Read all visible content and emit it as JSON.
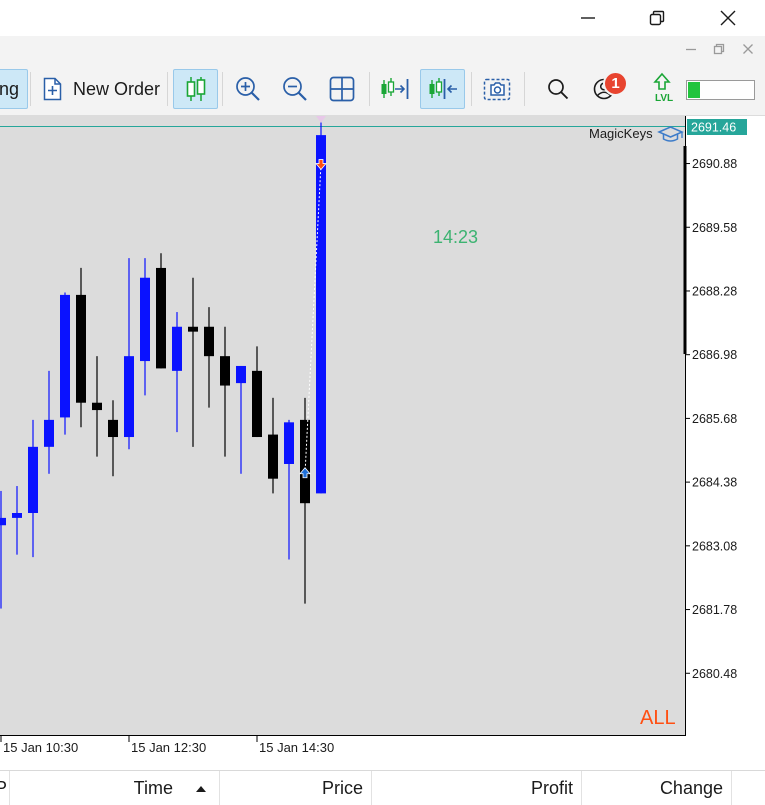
{
  "toolbar": {
    "trading_label": "ng",
    "new_order_label": "New Order",
    "notification_count": "1",
    "level_label": "LVL",
    "meter_fill": 0.18
  },
  "chart": {
    "current_price_label": "2691.46",
    "indicator_label": "MagicKeys",
    "countdown": "14:23",
    "filter_label": "ALL",
    "colors": {
      "background": "#dcdcdc",
      "bull": "#0a12ff",
      "bear": "#000000",
      "countdown": "#3cb371",
      "filter": "#ff4f12",
      "price_label_bg": "#26a69a"
    }
  },
  "chart_data": {
    "type": "candlestick",
    "timeframe": "M15",
    "price_ticks": [
      "2690.88",
      "2689.58",
      "2688.28",
      "2686.98",
      "2685.68",
      "2684.38",
      "2683.08",
      "2681.78",
      "2680.48"
    ],
    "time_labels": [
      "15 Jan 10:30",
      "15 Jan 12:30",
      "15 Jan 14:30"
    ],
    "ylim": [
      2679.2,
      2691.85
    ],
    "current_price": 2691.46,
    "candles": [
      {
        "o": 2683.5,
        "h": 2684.2,
        "l": 2681.8,
        "c": 2683.65
      },
      {
        "o": 2683.65,
        "h": 2684.3,
        "l": 2682.9,
        "c": 2683.75
      },
      {
        "o": 2683.75,
        "h": 2685.65,
        "l": 2682.85,
        "c": 2685.1
      },
      {
        "o": 2685.1,
        "h": 2686.65,
        "l": 2684.55,
        "c": 2685.65
      },
      {
        "o": 2685.7,
        "h": 2688.25,
        "l": 2685.35,
        "c": 2688.2
      },
      {
        "o": 2688.2,
        "h": 2688.75,
        "l": 2685.5,
        "c": 2686.0
      },
      {
        "o": 2686.0,
        "h": 2686.95,
        "l": 2684.9,
        "c": 2685.85
      },
      {
        "o": 2685.65,
        "h": 2686.05,
        "l": 2684.5,
        "c": 2685.3
      },
      {
        "o": 2685.3,
        "h": 2688.95,
        "l": 2685.05,
        "c": 2686.95
      },
      {
        "o": 2686.85,
        "h": 2688.95,
        "l": 2686.15,
        "c": 2688.55
      },
      {
        "o": 2688.75,
        "h": 2689.05,
        "l": 2686.7,
        "c": 2686.7
      },
      {
        "o": 2686.65,
        "h": 2687.85,
        "l": 2685.4,
        "c": 2687.55
      },
      {
        "o": 2687.55,
        "h": 2688.55,
        "l": 2685.1,
        "c": 2687.45
      },
      {
        "o": 2687.55,
        "h": 2687.95,
        "l": 2685.9,
        "c": 2686.95
      },
      {
        "o": 2686.95,
        "h": 2687.55,
        "l": 2684.9,
        "c": 2686.35
      },
      {
        "o": 2686.4,
        "h": 2686.75,
        "l": 2684.55,
        "c": 2686.75
      },
      {
        "o": 2686.65,
        "h": 2687.15,
        "l": 2685.3,
        "c": 2685.3
      },
      {
        "o": 2685.35,
        "h": 2686.1,
        "l": 2684.15,
        "c": 2684.45
      },
      {
        "o": 2684.75,
        "h": 2685.65,
        "l": 2682.8,
        "c": 2685.6
      },
      {
        "o": 2685.65,
        "h": 2686.1,
        "l": 2681.9,
        "c": 2683.95
      },
      {
        "o": 2684.15,
        "h": 2691.85,
        "l": 2684.15,
        "c": 2691.46
      }
    ],
    "trade_markers": [
      {
        "type": "buy",
        "price": 2684.55
      },
      {
        "type": "sell",
        "price": 2690.88
      }
    ]
  },
  "grid_header": {
    "col_first": "P",
    "time": "Time",
    "sort_icon": "sort-up-icon",
    "price": "Price",
    "profit": "Profit",
    "change": "Change"
  }
}
